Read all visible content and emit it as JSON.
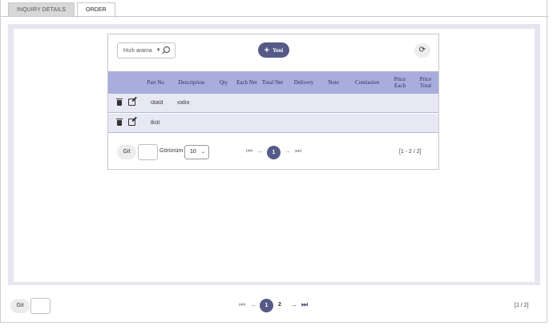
{
  "tabs": [
    {
      "label": "INQUIRY DETAILS",
      "active": false
    },
    {
      "label": "ORDER",
      "active": true
    }
  ],
  "toolbar": {
    "search_placeholder": "Hızlı arama",
    "new_label": "Yeni"
  },
  "table": {
    "columns": [
      "Part No",
      "Description",
      "Qty",
      "Each Net",
      "Total Net",
      "Delivery",
      "Note",
      "Comission",
      "Price Each",
      "Price Total"
    ],
    "rows": [
      {
        "part_no": "ütaüt",
        "description": "ıodıo"
      },
      {
        "part_no": "tküt",
        "description": ""
      }
    ]
  },
  "inner_pager": {
    "goto_label": "Git",
    "view_label": "Görünüm",
    "page_size": "10",
    "current_page": "1",
    "count_text": "[1 - 2 / 2]"
  },
  "outer_pager": {
    "goto_label": "Git",
    "current_page": "1",
    "next_page": "2",
    "count_text": "[1 / 2]"
  },
  "colors": {
    "accent": "#555a86",
    "header_bg": "#a9addd",
    "row_bg": "#e8e8f4",
    "panel_bg": "#e6e6f0"
  }
}
